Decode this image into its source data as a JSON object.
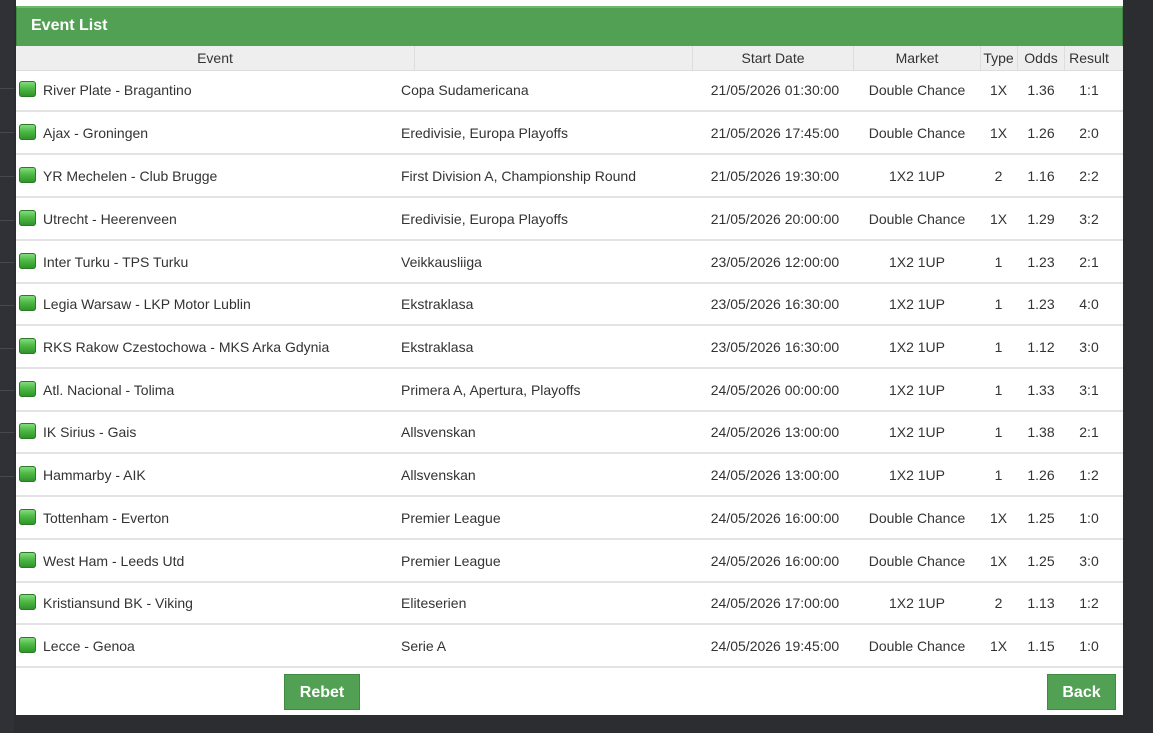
{
  "panel": {
    "title": "Event List"
  },
  "columns": {
    "event": "Event",
    "league": "",
    "start_date": "Start Date",
    "market": "Market",
    "type": "Type",
    "odds": "Odds",
    "result": "Result"
  },
  "rows": [
    {
      "event": "River Plate - Bragantino",
      "league": "Copa Sudamericana",
      "start_date": "21/05/2026 01:30:00",
      "market": "Double Chance",
      "type": "1X",
      "odds": "1.36",
      "result": "1:1"
    },
    {
      "event": "Ajax - Groningen",
      "league": "Eredivisie, Europa Playoffs",
      "start_date": "21/05/2026 17:45:00",
      "market": "Double Chance",
      "type": "1X",
      "odds": "1.26",
      "result": "2:0"
    },
    {
      "event": "YR Mechelen - Club Brugge",
      "league": "First Division A, Championship Round",
      "start_date": "21/05/2026 19:30:00",
      "market": "1X2 1UP",
      "type": "2",
      "odds": "1.16",
      "result": "2:2"
    },
    {
      "event": "Utrecht - Heerenveen",
      "league": "Eredivisie, Europa Playoffs",
      "start_date": "21/05/2026 20:00:00",
      "market": "Double Chance",
      "type": "1X",
      "odds": "1.29",
      "result": "3:2"
    },
    {
      "event": "Inter Turku - TPS Turku",
      "league": "Veikkausliiga",
      "start_date": "23/05/2026 12:00:00",
      "market": "1X2 1UP",
      "type": "1",
      "odds": "1.23",
      "result": "2:1"
    },
    {
      "event": "Legia Warsaw - LKP Motor Lublin",
      "league": "Ekstraklasa",
      "start_date": "23/05/2026 16:30:00",
      "market": "1X2 1UP",
      "type": "1",
      "odds": "1.23",
      "result": "4:0"
    },
    {
      "event": "RKS Rakow Czestochowa - MKS Arka Gdynia",
      "league": "Ekstraklasa",
      "start_date": "23/05/2026 16:30:00",
      "market": "1X2 1UP",
      "type": "1",
      "odds": "1.12",
      "result": "3:0"
    },
    {
      "event": "Atl. Nacional - Tolima",
      "league": "Primera A, Apertura, Playoffs",
      "start_date": "24/05/2026 00:00:00",
      "market": "1X2 1UP",
      "type": "1",
      "odds": "1.33",
      "result": "3:1"
    },
    {
      "event": "IK Sirius - Gais",
      "league": "Allsvenskan",
      "start_date": "24/05/2026 13:00:00",
      "market": "1X2 1UP",
      "type": "1",
      "odds": "1.38",
      "result": "2:1"
    },
    {
      "event": "Hammarby - AIK",
      "league": "Allsvenskan",
      "start_date": "24/05/2026 13:00:00",
      "market": "1X2 1UP",
      "type": "1",
      "odds": "1.26",
      "result": "1:2"
    },
    {
      "event": "Tottenham - Everton",
      "league": "Premier League",
      "start_date": "24/05/2026 16:00:00",
      "market": "Double Chance",
      "type": "1X",
      "odds": "1.25",
      "result": "1:0"
    },
    {
      "event": "West Ham - Leeds Utd",
      "league": "Premier League",
      "start_date": "24/05/2026 16:00:00",
      "market": "Double Chance",
      "type": "1X",
      "odds": "1.25",
      "result": "3:0"
    },
    {
      "event": "Kristiansund BK - Viking",
      "league": "Eliteserien",
      "start_date": "24/05/2026 17:00:00",
      "market": "1X2 1UP",
      "type": "2",
      "odds": "1.13",
      "result": "1:2"
    },
    {
      "event": "Lecce - Genoa",
      "league": "Serie A",
      "start_date": "24/05/2026 19:45:00",
      "market": "Double Chance",
      "type": "1X",
      "odds": "1.15",
      "result": "1:0"
    }
  ],
  "status_icon": "green-status-icon",
  "buttons": {
    "rebet": "Rebet",
    "back": "Back"
  },
  "colors": {
    "accent_green": "#52a053",
    "background_dark": "#2b2d31"
  }
}
